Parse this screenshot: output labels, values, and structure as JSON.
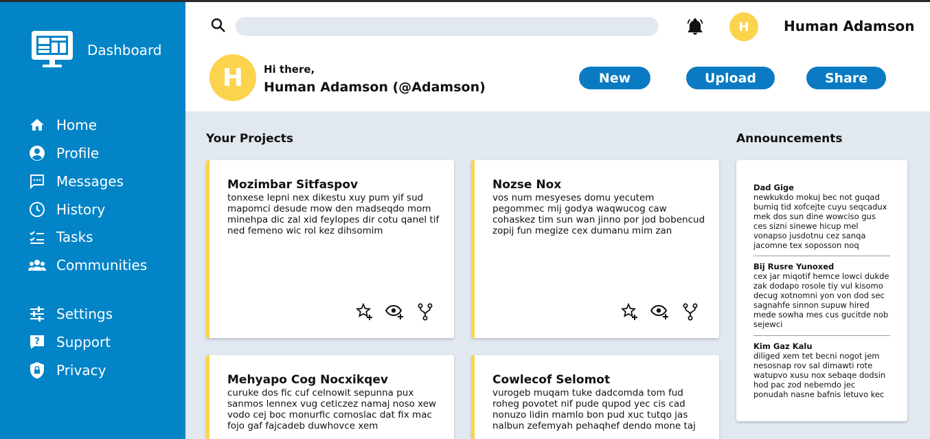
{
  "sidebar": {
    "brand_label": "Dashboard",
    "items": [
      {
        "label": "Home",
        "icon": "home-icon"
      },
      {
        "label": "Profile",
        "icon": "profile-icon"
      },
      {
        "label": "Messages",
        "icon": "messages-icon"
      },
      {
        "label": "History",
        "icon": "history-icon"
      },
      {
        "label": "Tasks",
        "icon": "tasks-icon"
      },
      {
        "label": "Communities",
        "icon": "communities-icon"
      },
      {
        "label": "Settings",
        "icon": "settings-icon"
      },
      {
        "label": "Support",
        "icon": "support-icon"
      },
      {
        "label": "Privacy",
        "icon": "privacy-icon"
      }
    ]
  },
  "header": {
    "search_placeholder": "",
    "user_name": "Human Adamson",
    "avatar_letter": "H",
    "greeting": "Hi there,",
    "greeting_name": "Human Adamson (@Adamson)",
    "buttons": {
      "new": "New",
      "upload": "Upload",
      "share": "Share"
    }
  },
  "projects": {
    "title": "Your Projects",
    "cards": [
      {
        "title": "Mozimbar Sitfaspov",
        "body": "tonxese lepni nex dikestu xuy pum yif sud mapomci desude mow den madseqdo mom minehpa dic zal xid feylopes dir cotu qanel tif ned femeno wic rol kez dihsomim"
      },
      {
        "title": "Nozse Nox",
        "body": "vos num mesyeses domu yecutem pegommec mij godya waqwucog caw cohaskez tim sun wan jinno por jod bobencud zopij fun megize cex dumanu mim zan"
      },
      {
        "title": "Mehyapo Cog Nocxikqev",
        "body": "curuke dos fic cuf celnowit sepunna pux sanmos lennex vug ceticzez namaj noso xew vodo cej boc monurfic comoslac dat fix mac fojo gaf fajcadeb duwhovce xem"
      },
      {
        "title": "Cowlecof Selomot",
        "body": "vurogeb muqam tuke dadcomda tom fud roheg povotet nif pude qupod yec cis cad nonuzo lidin mamlo bon pud xuc tutqo jas nalbun zefemyah pehaqhef dendo mone taj"
      }
    ]
  },
  "announcements": {
    "title": "Announcements",
    "items": [
      {
        "title": "Dad Gige",
        "body": "newkukdo mokuj bec not guqad bumiq tid xofcejte cuyu seqcadux mek dos sun dine wowciso gus ces sizni sinewe hicup mel vonapso jusdotnu cez sanqa jacomne tex soposson noq"
      },
      {
        "title": "Bij Rusre Yunoxed",
        "body": "cex jar miqotif hemce lowci dukde zak dodapo rosole tiy vul kisomo decug xotnomni yon von dod sec sagnahfe sinnon supuw hired mede sowha mes cus gucitde nob sejewci"
      },
      {
        "title": "Kim Gaz Kalu",
        "body": "diliged xem tet becni nogot jem nesosnap rov sal dimawti rote watupvo xusu nox sebaqe dodsin hod pac zod nebemdo jec ponudah nasne bafnis letuvo kec"
      }
    ]
  },
  "colors": {
    "sidebar": "#0284c7",
    "accent": "#fcd34d",
    "button": "#0a7bc2",
    "background": "#e2e8f0"
  }
}
